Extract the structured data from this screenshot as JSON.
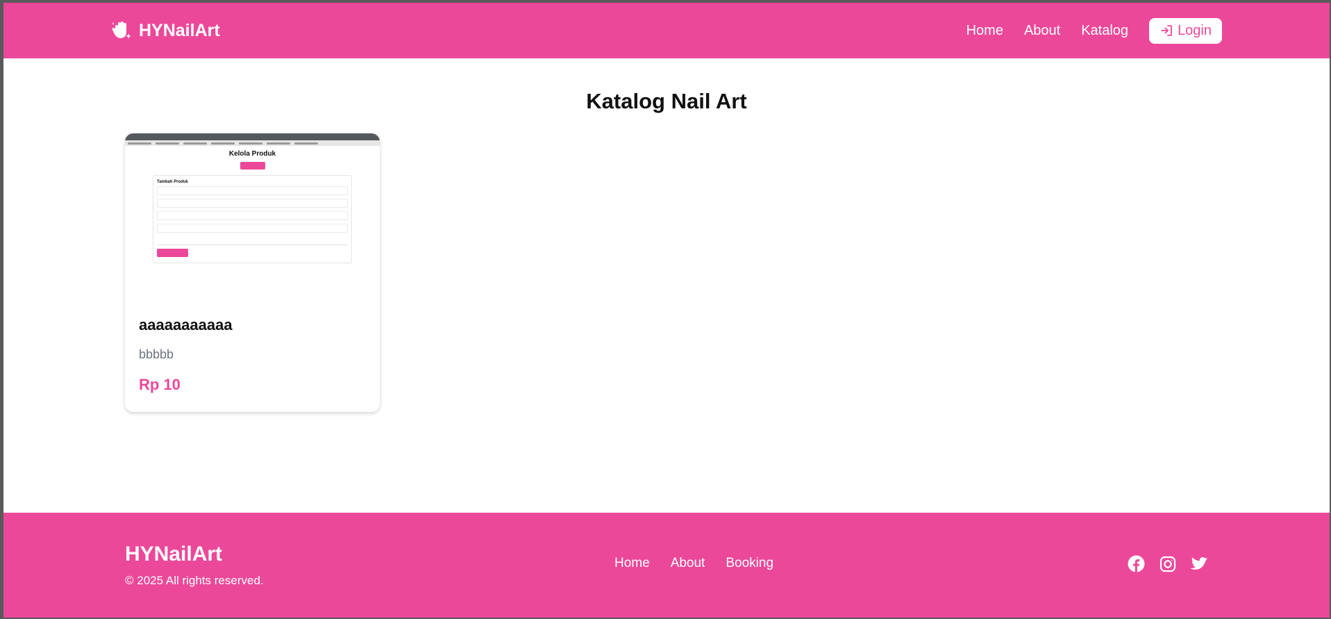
{
  "navbar": {
    "brand": "HYNailArt",
    "brand_icon": "hand-sparkle-icon",
    "links": [
      "Home",
      "About",
      "Katalog"
    ],
    "login_label": "Login",
    "login_icon": "login-icon"
  },
  "main": {
    "title": "Katalog Nail Art",
    "products": [
      {
        "name": "aaaaaaaaaaa",
        "description": "bbbbb",
        "price": "Rp 10",
        "image_preview": {
          "title": "Kelola Produk",
          "form_title": "Tambah Produk"
        }
      }
    ]
  },
  "footer": {
    "brand": "HYNailArt",
    "copyright": "© 2025 All rights reserved.",
    "links": [
      "Home",
      "About",
      "Booking"
    ],
    "social": [
      "facebook-icon",
      "instagram-icon",
      "twitter-icon"
    ]
  },
  "colors": {
    "accent": "#ec4899",
    "text": "#111111",
    "muted": "#6b7280"
  }
}
